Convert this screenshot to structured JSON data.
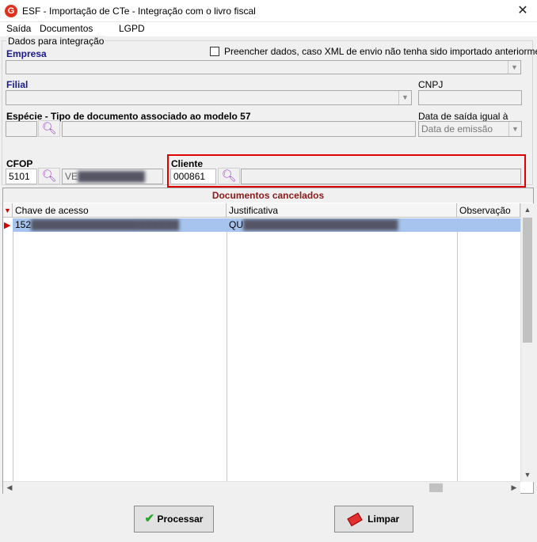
{
  "window": {
    "title": "ESF - Importação de CTe - Integração com o livro fiscal",
    "app_icon": "G",
    "close_glyph": "✕"
  },
  "menu": [
    "Saída",
    "Documentos",
    "LGPD"
  ],
  "group": {
    "legend": "Dados para integração",
    "empresa_label": "Empresa",
    "checkbox_label": "Preencher dados, caso XML de envio não tenha sido importado anteriormente",
    "filial_label": "Filial",
    "cnpj_label": "CNPJ",
    "especie_label": "Espécie - Tipo de documento associado ao modelo 57",
    "data_saida_label": "Data de saída igual à",
    "data_saida_value": "Data de emissão",
    "cfop_label": "CFOP",
    "cfop_value": "5101",
    "cfop_desc": "VE",
    "cliente_label": "Cliente",
    "cliente_value": "000861"
  },
  "grid": {
    "title": "Documentos cancelados",
    "columns": [
      "Chave de acesso",
      "Justificativa",
      "Observação"
    ],
    "rows": [
      {
        "chave": "152",
        "justificativa": "QU",
        "observacao": ""
      }
    ]
  },
  "buttons": {
    "processar": "Processar",
    "limpar": "Limpar"
  },
  "colors": {
    "highlight": "#e00000",
    "selected_row": "#a6c4ee",
    "grid_title": "#8b1a1a",
    "search_icon": "#a049c8"
  }
}
